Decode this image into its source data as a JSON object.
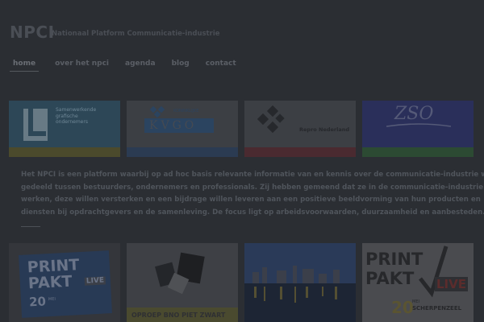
{
  "site": {
    "title": "NPCI",
    "tagline": "Nationaal Platform Communicatie-industrie"
  },
  "nav": [
    {
      "label": "home",
      "active": true
    },
    {
      "label": "over het npci",
      "active": false
    },
    {
      "label": "agenda",
      "active": false
    },
    {
      "label": "blog",
      "active": false
    },
    {
      "label": "contact",
      "active": false
    }
  ],
  "partners": [
    {
      "name": "",
      "logo_text": [
        "Samenwerkende",
        "grafische",
        "ondernemers",
        "",
        ""
      ],
      "stripe_color": "#4b4a2c"
    },
    {
      "name": "KVGO",
      "logo_text": [
        "KONINKLIJKE",
        "KVGO"
      ],
      "stripe_color": "#2b3b52"
    },
    {
      "name": "Repro Nederland",
      "logo_text": [
        "Repro Nederland"
      ],
      "stripe_color": "#4a2a30"
    },
    {
      "name": "ZSO",
      "logo_text": [
        "ZSO"
      ],
      "stripe_color": "#2c4a33"
    }
  ],
  "intro_lines": [
    "Het NPCI is een platform waarbij op ad hoc basis relevante informatie van en kennis over de communicatie-industrie wordt",
    "gedeeld tussen bestuurders, ondernemers en professionals. Zij hebben gemeend dat ze in de communicatie-industrie",
    "werken, deze willen versterken en een bijdrage willen leveren aan een positieve beeldvorming van hun producten en",
    "diensten bij opdrachtgevers en de samenleving. De focus ligt op arbeidsvoorwaarden, duurzaamheid en aanbesteden."
  ],
  "posts": [
    {
      "caption": "",
      "image_text": [
        "PRINT",
        "PAKT",
        "LIVE",
        "20",
        "MEI"
      ]
    },
    {
      "caption": "OPROEP BNO PIET ZWART",
      "image_text": []
    },
    {
      "caption": "",
      "image_text": []
    },
    {
      "caption": "",
      "image_text": [
        "PRINT",
        "PAKT",
        "LIVE",
        "20",
        "MEI",
        "SCHERPENZEEL"
      ]
    }
  ]
}
